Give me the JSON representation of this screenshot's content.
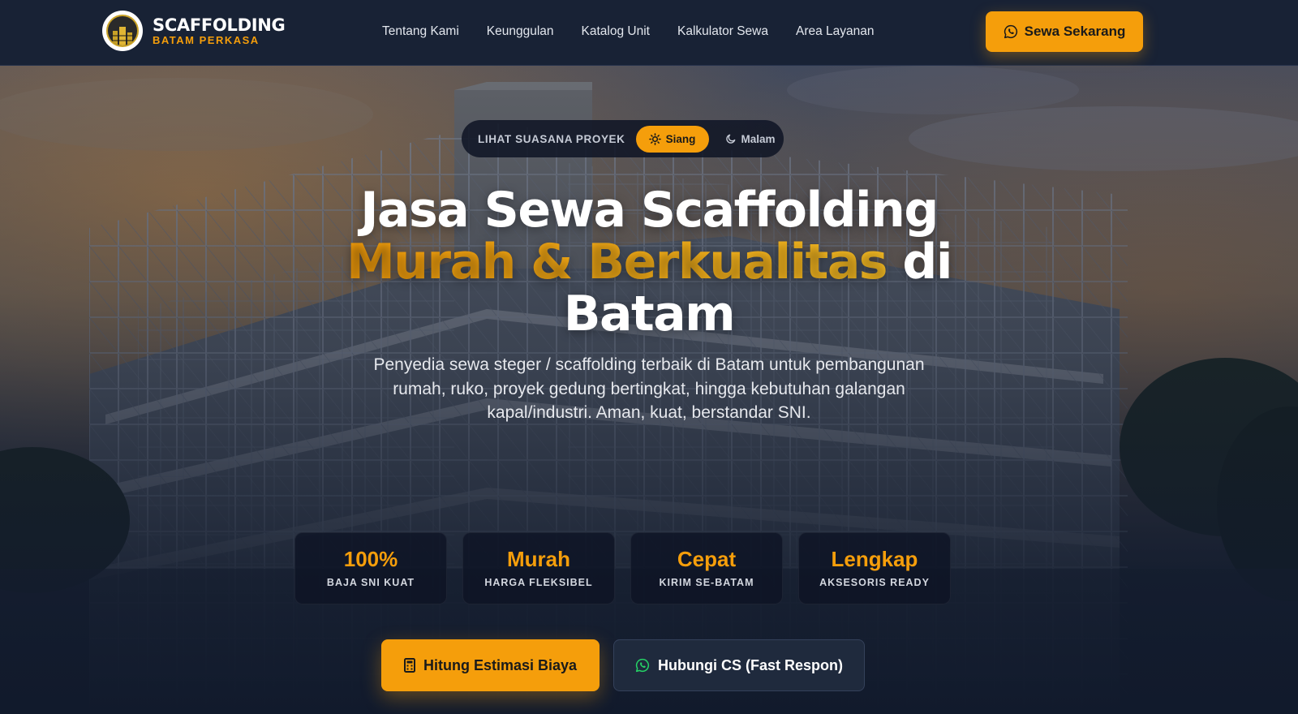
{
  "brand": {
    "title": "SCAFFOLDING",
    "subtitle": "BATAM PERKASA",
    "logo_icon": "building-logo-icon"
  },
  "nav": {
    "links": [
      "Tentang Kami",
      "Keunggulan",
      "Katalog Unit",
      "Kalkulator Sewa",
      "Area Layanan"
    ],
    "cta_label": "Sewa Sekarang",
    "cta_icon": "whatsapp-icon"
  },
  "hero": {
    "mode_toggle": {
      "label": "LIHAT SUASANA PROYEK",
      "day_label": "Siang",
      "night_label": "Malam",
      "selected": "Siang"
    },
    "headline": {
      "line1": "Jasa Sewa Scaffolding",
      "accent": "Murah & Berkualitas",
      "after_accent": " di",
      "line3": "Batam"
    },
    "subtitle": "Penyedia sewa steger / scaffolding terbaik di Batam untuk pembangunan rumah, ruko, proyek gedung bertingkat, hingga kebutuhan galangan kapal/industri. Aman, kuat, berstandar SNI.",
    "stats": [
      {
        "value": "100%",
        "label": "BAJA SNI KUAT"
      },
      {
        "value": "Murah",
        "label": "HARGA FLEKSIBEL"
      },
      {
        "value": "Cepat",
        "label": "KIRIM SE-BATAM"
      },
      {
        "value": "Lengkap",
        "label": "AKSESORIS READY"
      }
    ],
    "primary_button": "Hitung Estimasi Biaya",
    "primary_icon": "calculator-icon",
    "secondary_button": "Hubungi CS (Fast Respon)",
    "secondary_icon": "whatsapp-icon"
  },
  "colors": {
    "accent": "#f59e0b",
    "navbar_bg": "#182235",
    "page_bg": "#111a2c",
    "whatsapp_green": "#25d366"
  }
}
